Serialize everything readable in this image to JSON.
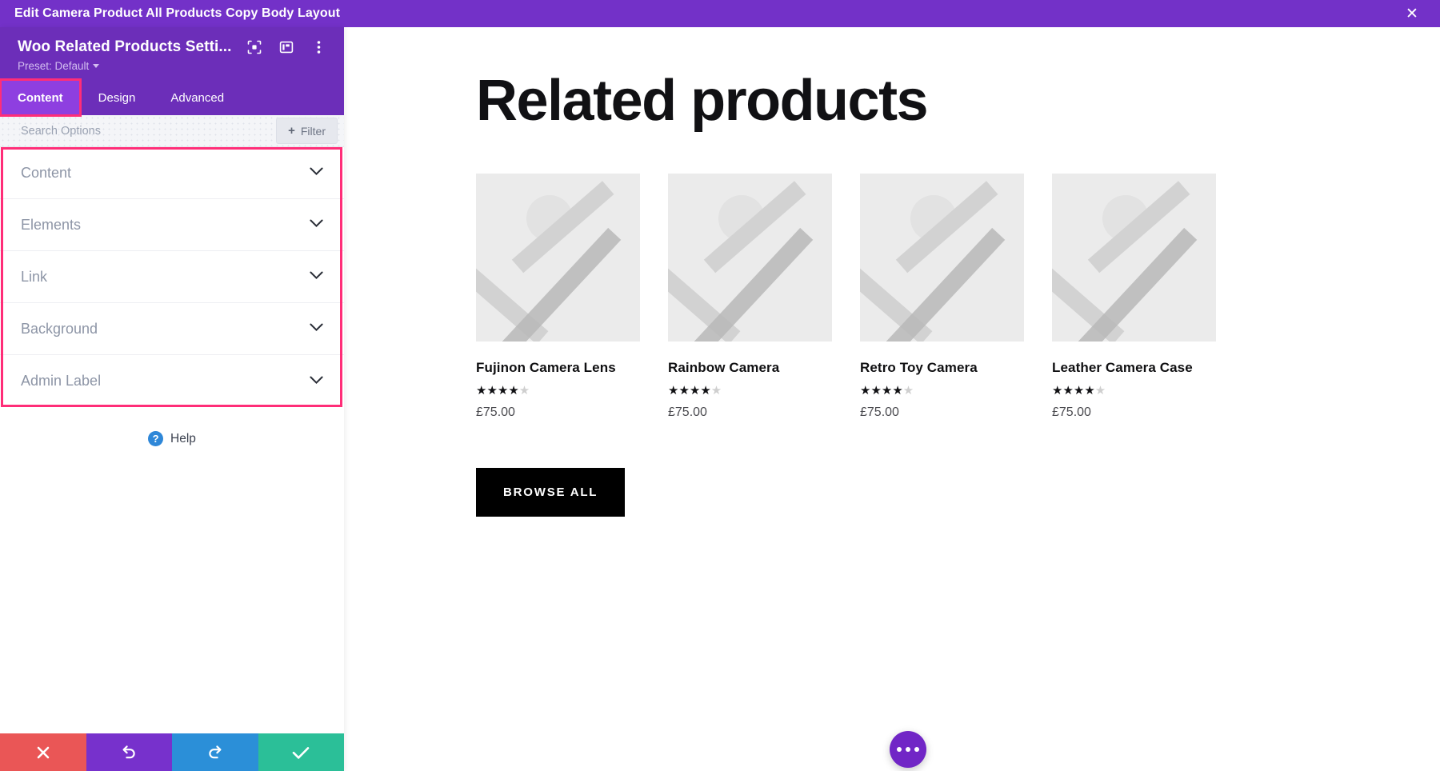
{
  "window": {
    "title": "Edit Camera Product All Products Copy Body Layout",
    "close_label": "✕"
  },
  "panel": {
    "title": "Woo Related Products Setti...",
    "preset_label": "Preset: Default",
    "icons": [
      "focus-icon",
      "layout-panel-icon",
      "kebab-menu-icon"
    ],
    "tabs": [
      {
        "label": "Content",
        "active": true
      },
      {
        "label": "Design",
        "active": false
      },
      {
        "label": "Advanced",
        "active": false
      }
    ],
    "search": {
      "placeholder": "Search Options",
      "value": ""
    },
    "filter_button": {
      "label": "Filter",
      "plus": "+"
    },
    "sections": [
      {
        "label": "Content"
      },
      {
        "label": "Elements"
      },
      {
        "label": "Link"
      },
      {
        "label": "Background"
      },
      {
        "label": "Admin Label"
      }
    ],
    "help": {
      "label": "Help",
      "icon_glyph": "?"
    },
    "actions": [
      {
        "name": "cancel-button",
        "icon": "close-icon"
      },
      {
        "name": "undo-button",
        "icon": "undo-icon"
      },
      {
        "name": "redo-button",
        "icon": "redo-icon"
      },
      {
        "name": "save-button",
        "icon": "check-icon"
      }
    ],
    "highlight_color": "#ff2d78",
    "header_color": "#6c2eb9",
    "active_tab_color": "#8e3fe0"
  },
  "main": {
    "heading": "Related products",
    "products": [
      {
        "name": "Fujinon Camera Lens",
        "rating": 4,
        "rating_max": 5,
        "price": "£75.00"
      },
      {
        "name": "Rainbow Camera",
        "rating": 4,
        "rating_max": 5,
        "price": "£75.00"
      },
      {
        "name": "Retro Toy Camera",
        "rating": 4,
        "rating_max": 5,
        "price": "£75.00"
      },
      {
        "name": "Leather Camera Case",
        "rating": 4,
        "rating_max": 5,
        "price": "£75.00"
      }
    ],
    "browse_all_label": "BROWSE ALL",
    "fab": {
      "name": "more-options-fab",
      "dots": 3,
      "color": "#7126c6"
    }
  }
}
